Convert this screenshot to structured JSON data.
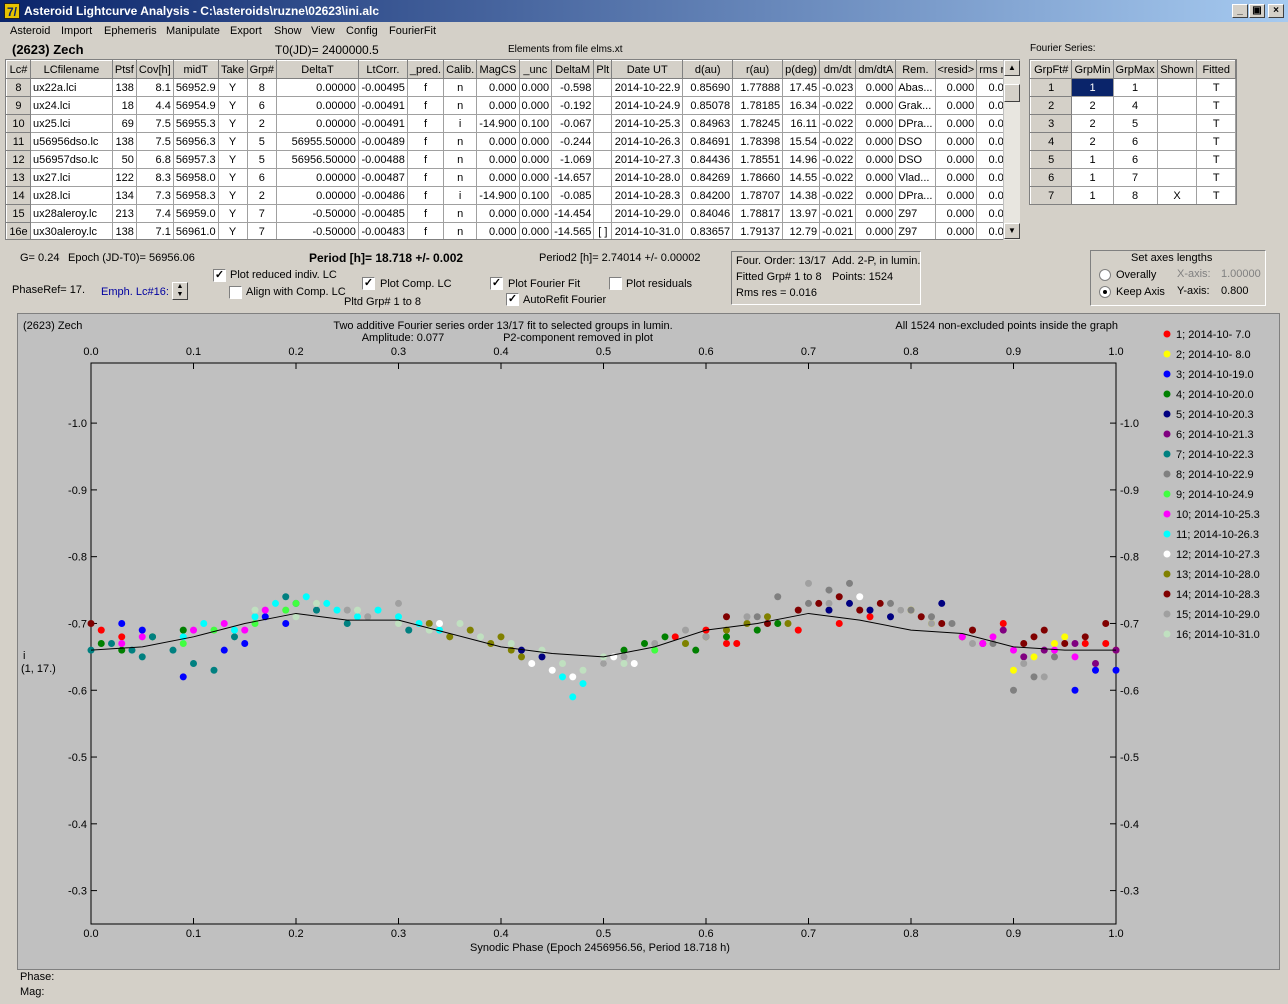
{
  "window": {
    "title": "Asteroid Lightcurve Analysis - C:\\asteroids\\ruzne\\02623\\ini.alc",
    "icon_glyph": "7/",
    "buttons": [
      "_",
      "▣",
      "×"
    ]
  },
  "menu": [
    "Asteroid",
    "Import",
    "Ephemeris",
    "Manipulate",
    "Export",
    "Show",
    "View",
    "Config",
    "FourierFit"
  ],
  "header": {
    "object": "(2623) Zech",
    "t0": "T0(JD)= 2400000.5",
    "elements": "Elements from file elms.xt",
    "fourier_series_label": "Fourier Series:"
  },
  "lc_table": {
    "columns": [
      "Lc#",
      "LCfilename",
      "Ptsf",
      "Cov[h]",
      "midT",
      "Take",
      "Grp#",
      "DeltaT",
      "LtCorr.",
      "_pred.",
      "Calib.",
      "MagCS",
      "_unc",
      "DeltaM",
      "Plt",
      "Date UT",
      "d(au)",
      "r(au)",
      "p(deg)",
      "dm/dt",
      "dm/dtA",
      "Rem.",
      "<resid>",
      "rms res"
    ],
    "rows": [
      [
        "8",
        "ux22a.lci",
        "138",
        "8.1",
        "56952.9",
        "Y",
        "8",
        "0.00000",
        "-0.00495",
        "f",
        "n",
        "0.000",
        "0.000",
        "-0.598",
        "",
        "2014-10-22.9",
        "0.85690",
        "1.77888",
        "17.45",
        "-0.023",
        "0.000",
        "Abas...",
        "0.000",
        "0.007"
      ],
      [
        "9",
        "ux24.lci",
        "18",
        "4.4",
        "56954.9",
        "Y",
        "6",
        "0.00000",
        "-0.00491",
        "f",
        "n",
        "0.000",
        "0.000",
        "-0.192",
        "",
        "2014-10-24.9",
        "0.85078",
        "1.78185",
        "16.34",
        "-0.022",
        "0.000",
        "Grak...",
        "0.000",
        "0.007"
      ],
      [
        "10",
        "ux25.lci",
        "69",
        "7.5",
        "56955.3",
        "Y",
        "2",
        "0.00000",
        "-0.00491",
        "f",
        "i",
        "-14.900",
        "0.100",
        "-0.067",
        "",
        "2014-10-25.3",
        "0.84963",
        "1.78245",
        "16.11",
        "-0.022",
        "0.000",
        "DPra...",
        "0.000",
        "0.012"
      ],
      [
        "11",
        "u56956dso.lc",
        "138",
        "7.5",
        "56956.3",
        "Y",
        "5",
        "56955.50000",
        "-0.00489",
        "f",
        "n",
        "0.000",
        "0.000",
        "-0.244",
        "",
        "2014-10-26.3",
        "0.84691",
        "1.78398",
        "15.54",
        "-0.022",
        "0.000",
        "DSO",
        "0.000",
        "0.017"
      ],
      [
        "12",
        "u56957dso.lc",
        "50",
        "6.8",
        "56957.3",
        "Y",
        "5",
        "56956.50000",
        "-0.00488",
        "f",
        "n",
        "0.000",
        "0.000",
        "-1.069",
        "",
        "2014-10-27.3",
        "0.84436",
        "1.78551",
        "14.96",
        "-0.022",
        "0.000",
        "DSO",
        "0.000",
        "0.016"
      ],
      [
        "13",
        "ux27.lci",
        "122",
        "8.3",
        "56958.0",
        "Y",
        "6",
        "0.00000",
        "-0.00487",
        "f",
        "n",
        "0.000",
        "0.000",
        "-14.657",
        "",
        "2014-10-28.0",
        "0.84269",
        "1.78660",
        "14.55",
        "-0.022",
        "0.000",
        "Vlad...",
        "0.000",
        "0.013"
      ],
      [
        "14",
        "ux28.lci",
        "134",
        "7.3",
        "56958.3",
        "Y",
        "2",
        "0.00000",
        "-0.00486",
        "f",
        "i",
        "-14.900",
        "0.100",
        "-0.085",
        "",
        "2014-10-28.3",
        "0.84200",
        "1.78707",
        "14.38",
        "-0.022",
        "0.000",
        "DPra...",
        "0.000",
        "0.017"
      ],
      [
        "15",
        "ux28aleroy.lc",
        "213",
        "7.4",
        "56959.0",
        "Y",
        "7",
        "-0.50000",
        "-0.00485",
        "f",
        "n",
        "0.000",
        "0.000",
        "-14.454",
        "",
        "2014-10-29.0",
        "0.84046",
        "1.78817",
        "13.97",
        "-0.021",
        "0.000",
        "Z97",
        "0.000",
        "0.018"
      ],
      [
        "16e",
        "ux30aleroy.lc",
        "138",
        "7.1",
        "56961.0",
        "Y",
        "7",
        "-0.50000",
        "-0.00483",
        "f",
        "n",
        "0.000",
        "0.000",
        "-14.565",
        "[ ]",
        "2014-10-31.0",
        "0.83657",
        "1.79137",
        "12.79",
        "-0.021",
        "0.000",
        "Z97",
        "0.000",
        "0.017"
      ]
    ]
  },
  "fourier_table": {
    "columns": [
      "GrpFt#",
      "GrpMin",
      "GrpMax",
      "Shown",
      "Fitted"
    ],
    "rows": [
      [
        "1",
        "1",
        "1",
        "",
        "T"
      ],
      [
        "2",
        "2",
        "4",
        "",
        "T"
      ],
      [
        "3",
        "2",
        "5",
        "",
        "T"
      ],
      [
        "4",
        "2",
        "6",
        "",
        "T"
      ],
      [
        "5",
        "1",
        "6",
        "",
        "T"
      ],
      [
        "6",
        "1",
        "7",
        "",
        "T"
      ],
      [
        "7",
        "1",
        "8",
        "X",
        "T"
      ]
    ],
    "selected_cell": "GrpMin row 1"
  },
  "controls": {
    "g": "G= 0.24",
    "epoch": "Epoch (JD-T0)= 56956.06",
    "period": "Period [h]= 18.718 +/- 0.002",
    "period2": "Period2 [h]= 2.74014 +/- 0.00002",
    "phaseref": "PhaseRef= 17.",
    "emph": "Emph. Lc#16:",
    "plot_reduced": {
      "label": "Plot reduced indiv. LC",
      "checked": true
    },
    "align_comp": {
      "label": "Align with Comp. LC",
      "checked": false
    },
    "plot_comp": {
      "label": "Plot Comp. LC",
      "checked": true
    },
    "pltd_grp": "Pltd Grp#  1   to   8",
    "plot_fourier": {
      "label": "Plot Fourier Fit",
      "checked": true
    },
    "autorefit": {
      "label": "AutoRefit Fourier",
      "checked": true
    },
    "plot_residuals": {
      "label": "Plot residuals",
      "checked": false
    },
    "four_order": "Four. Order: 13/17",
    "add_2p": "Add. 2-P, in lumin.",
    "fitted_grp": "Fitted Grp# 1 to 8",
    "points": "Points: 1524",
    "rms": "Rms res     = 0.016",
    "axes_title": "Set axes lengths",
    "overally": {
      "label": "Overally",
      "selected": false
    },
    "keep_axis": {
      "label": "Keep Axis",
      "selected": true
    },
    "xaxis_label": "X-axis:",
    "xaxis_value": "1.00000",
    "yaxis_label": "Y-axis:",
    "yaxis_value": "0.800"
  },
  "plot_text": {
    "top_left": "(2623) Zech",
    "center_line1": "Two additive Fourier series order 13/17 fit to selected groups in lumin.",
    "center_line2a": "Amplitude: 0.077",
    "center_line2b": "P2-component removed in plot",
    "top_right": "All 1524 non-excluded points inside the graph",
    "ylabel_1": "i",
    "ylabel_2": "(1, 17.)"
  },
  "status": {
    "phase": "Phase:",
    "mag": "Mag:"
  },
  "chart_data": {
    "type": "scatter",
    "xlabel": "Synodic Phase (Epoch 2456956.56, Period 18.718 h)",
    "ylabel": "i (1, 17.)",
    "xlim": [
      0.0,
      1.0
    ],
    "ylim": [
      -1.09,
      -0.25
    ],
    "y_inverted": true,
    "xticks": [
      "0.0",
      "0.1",
      "0.2",
      "0.3",
      "0.4",
      "0.5",
      "0.6",
      "0.7",
      "0.8",
      "0.9",
      "1.0"
    ],
    "yticks": [
      "-1.0",
      "-0.9",
      "-0.8",
      "-0.7",
      "-0.6",
      "-0.5",
      "-0.4",
      "-0.3"
    ],
    "ytick_values": [
      -1.0,
      -0.9,
      -0.8,
      -0.7,
      -0.6,
      -0.5,
      -0.4,
      -0.3
    ],
    "legend_position": "right",
    "fit_curve": {
      "x": [
        0.0,
        0.05,
        0.1,
        0.15,
        0.2,
        0.25,
        0.3,
        0.35,
        0.4,
        0.45,
        0.5,
        0.55,
        0.6,
        0.65,
        0.7,
        0.75,
        0.8,
        0.85,
        0.9,
        0.95,
        1.0
      ],
      "y": [
        -0.66,
        -0.665,
        -0.68,
        -0.7,
        -0.715,
        -0.705,
        -0.705,
        -0.685,
        -0.665,
        -0.655,
        -0.65,
        -0.665,
        -0.69,
        -0.7,
        -0.715,
        -0.705,
        -0.69,
        -0.685,
        -0.665,
        -0.66,
        -0.66
      ]
    },
    "series": [
      {
        "name": "1; 2014-10- 7.0",
        "color": "#ff0000",
        "x": [
          0.57,
          0.6,
          0.62,
          0.63,
          0.69,
          0.73,
          0.76,
          0.99,
          0.97,
          1.0,
          0.03,
          0.01,
          0.89
        ],
        "y": [
          -0.68,
          -0.69,
          -0.67,
          -0.67,
          -0.69,
          -0.7,
          -0.71,
          -0.67,
          -0.67,
          -0.66,
          -0.68,
          -0.69,
          -0.7
        ]
      },
      {
        "name": "2; 2014-10- 8.0",
        "color": "#ffff00",
        "x": [
          0.8,
          0.82,
          0.85,
          0.87,
          0.88,
          0.9,
          0.92,
          0.94,
          0.95
        ],
        "y": [
          -0.72,
          -0.7,
          -0.68,
          -0.67,
          -0.68,
          -0.63,
          -0.65,
          -0.67,
          -0.68
        ]
      },
      {
        "name": "3; 2014-10-19.0",
        "color": "#0000ff",
        "x": [
          0.03,
          0.05,
          0.09,
          0.13,
          0.15,
          0.17,
          0.19,
          0.96,
          0.98,
          1.0
        ],
        "y": [
          -0.7,
          -0.69,
          -0.62,
          -0.66,
          -0.67,
          -0.71,
          -0.7,
          -0.6,
          -0.63,
          -0.63
        ]
      },
      {
        "name": "4; 2014-10-20.0",
        "color": "#008000",
        "x": [
          0.01,
          0.03,
          0.06,
          0.09,
          0.52,
          0.54,
          0.56,
          0.59,
          0.62,
          0.65,
          0.67
        ],
        "y": [
          -0.67,
          -0.66,
          -0.68,
          -0.69,
          -0.66,
          -0.67,
          -0.68,
          -0.66,
          -0.68,
          -0.69,
          -0.7
        ]
      },
      {
        "name": "5; 2014-10-20.3",
        "color": "#000080",
        "x": [
          0.42,
          0.44,
          0.72,
          0.74,
          0.76,
          0.78,
          0.83
        ],
        "y": [
          -0.66,
          -0.65,
          -0.72,
          -0.73,
          -0.72,
          -0.71,
          -0.73
        ]
      },
      {
        "name": "6; 2014-10-21.3",
        "color": "#800080",
        "x": [
          0.85,
          0.87,
          0.89,
          0.91,
          0.93,
          0.96,
          0.98,
          1.0
        ],
        "y": [
          -0.68,
          -0.67,
          -0.69,
          -0.65,
          -0.66,
          -0.67,
          -0.64,
          -0.66
        ]
      },
      {
        "name": "7; 2014-10-22.3",
        "color": "#008080",
        "x": [
          0.0,
          0.02,
          0.04,
          0.05,
          0.06,
          0.08,
          0.1,
          0.12,
          0.14,
          0.19,
          0.2,
          0.22,
          0.25,
          0.31
        ],
        "y": [
          -0.66,
          -0.67,
          -0.66,
          -0.65,
          -0.68,
          -0.66,
          -0.64,
          -0.63,
          -0.68,
          -0.74,
          -0.73,
          -0.72,
          -0.7,
          -0.69
        ]
      },
      {
        "name": "8; 2014-10-22.9",
        "color": "#808080",
        "x": [
          0.65,
          0.67,
          0.7,
          0.72,
          0.74,
          0.78,
          0.8,
          0.82,
          0.84,
          0.86,
          0.88,
          0.9,
          0.92,
          0.94
        ],
        "y": [
          -0.71,
          -0.74,
          -0.73,
          -0.75,
          -0.76,
          -0.73,
          -0.72,
          -0.71,
          -0.7,
          -0.69,
          -0.67,
          -0.6,
          -0.62,
          -0.65
        ]
      },
      {
        "name": "9; 2014-10-24.9",
        "color": "#40ff40",
        "x": [
          0.09,
          0.12,
          0.16,
          0.19,
          0.2,
          0.55,
          0.58
        ],
        "y": [
          -0.67,
          -0.69,
          -0.7,
          -0.72,
          -0.73,
          -0.66,
          -0.67
        ]
      },
      {
        "name": "10; 2014-10-25.3",
        "color": "#ff00ff",
        "x": [
          0.03,
          0.05,
          0.1,
          0.13,
          0.15,
          0.17,
          0.85,
          0.87,
          0.88,
          0.9,
          0.94,
          0.96
        ],
        "y": [
          -0.67,
          -0.68,
          -0.69,
          -0.7,
          -0.69,
          -0.72,
          -0.68,
          -0.67,
          -0.68,
          -0.66,
          -0.66,
          -0.65
        ]
      },
      {
        "name": "11; 2014-10-26.3",
        "color": "#00ffff",
        "x": [
          0.09,
          0.11,
          0.14,
          0.16,
          0.18,
          0.21,
          0.23,
          0.24,
          0.26,
          0.28,
          0.3,
          0.32,
          0.34,
          0.46,
          0.47,
          0.48
        ],
        "y": [
          -0.68,
          -0.7,
          -0.69,
          -0.71,
          -0.73,
          -0.74,
          -0.73,
          -0.72,
          -0.71,
          -0.72,
          -0.71,
          -0.7,
          -0.69,
          -0.62,
          -0.59,
          -0.61
        ]
      },
      {
        "name": "12; 2014-10-27.3",
        "color": "#ffffff",
        "x": [
          0.34,
          0.41,
          0.43,
          0.45,
          0.47,
          0.5,
          0.51,
          0.53,
          0.75,
          0.77,
          0.79
        ],
        "y": [
          -0.7,
          -0.66,
          -0.64,
          -0.63,
          -0.62,
          -0.64,
          -0.65,
          -0.64,
          -0.74,
          -0.73,
          -0.72
        ]
      },
      {
        "name": "13; 2014-10-28.0",
        "color": "#808000",
        "x": [
          0.33,
          0.35,
          0.37,
          0.39,
          0.4,
          0.41,
          0.42,
          0.58,
          0.6,
          0.62,
          0.64,
          0.66,
          0.68
        ],
        "y": [
          -0.7,
          -0.68,
          -0.69,
          -0.67,
          -0.68,
          -0.66,
          -0.65,
          -0.67,
          -0.68,
          -0.69,
          -0.7,
          -0.71,
          -0.7
        ]
      },
      {
        "name": "14; 2014-10-28.3",
        "color": "#800000",
        "x": [
          0.0,
          0.62,
          0.66,
          0.69,
          0.71,
          0.73,
          0.75,
          0.77,
          0.81,
          0.83,
          0.86,
          0.91,
          0.92,
          0.93,
          0.95,
          0.97,
          0.99
        ],
        "y": [
          -0.7,
          -0.71,
          -0.7,
          -0.72,
          -0.73,
          -0.74,
          -0.72,
          -0.73,
          -0.71,
          -0.7,
          -0.69,
          -0.67,
          -0.68,
          -0.69,
          -0.67,
          -0.68,
          -0.7
        ]
      },
      {
        "name": "15; 2014-10-29.0",
        "color": "#a0a0a0",
        "x": [
          0.25,
          0.27,
          0.3,
          0.5,
          0.52,
          0.55,
          0.58,
          0.6,
          0.64,
          0.7,
          0.72,
          0.79,
          0.82,
          0.86,
          0.91,
          0.93
        ],
        "y": [
          -0.72,
          -0.71,
          -0.73,
          -0.64,
          -0.65,
          -0.67,
          -0.69,
          -0.68,
          -0.71,
          -0.76,
          -0.73,
          -0.72,
          -0.7,
          -0.67,
          -0.64,
          -0.62
        ]
      },
      {
        "name": "16; 2014-10-31.0",
        "color": "#c0e0c0",
        "x": [
          0.16,
          0.2,
          0.22,
          0.26,
          0.3,
          0.33,
          0.36,
          0.38,
          0.41,
          0.44,
          0.46,
          0.48,
          0.5,
          0.52
        ],
        "y": [
          -0.72,
          -0.71,
          -0.73,
          -0.72,
          -0.7,
          -0.69,
          -0.7,
          -0.68,
          -0.67,
          -0.66,
          -0.64,
          -0.63,
          -0.65,
          -0.64
        ]
      }
    ]
  }
}
